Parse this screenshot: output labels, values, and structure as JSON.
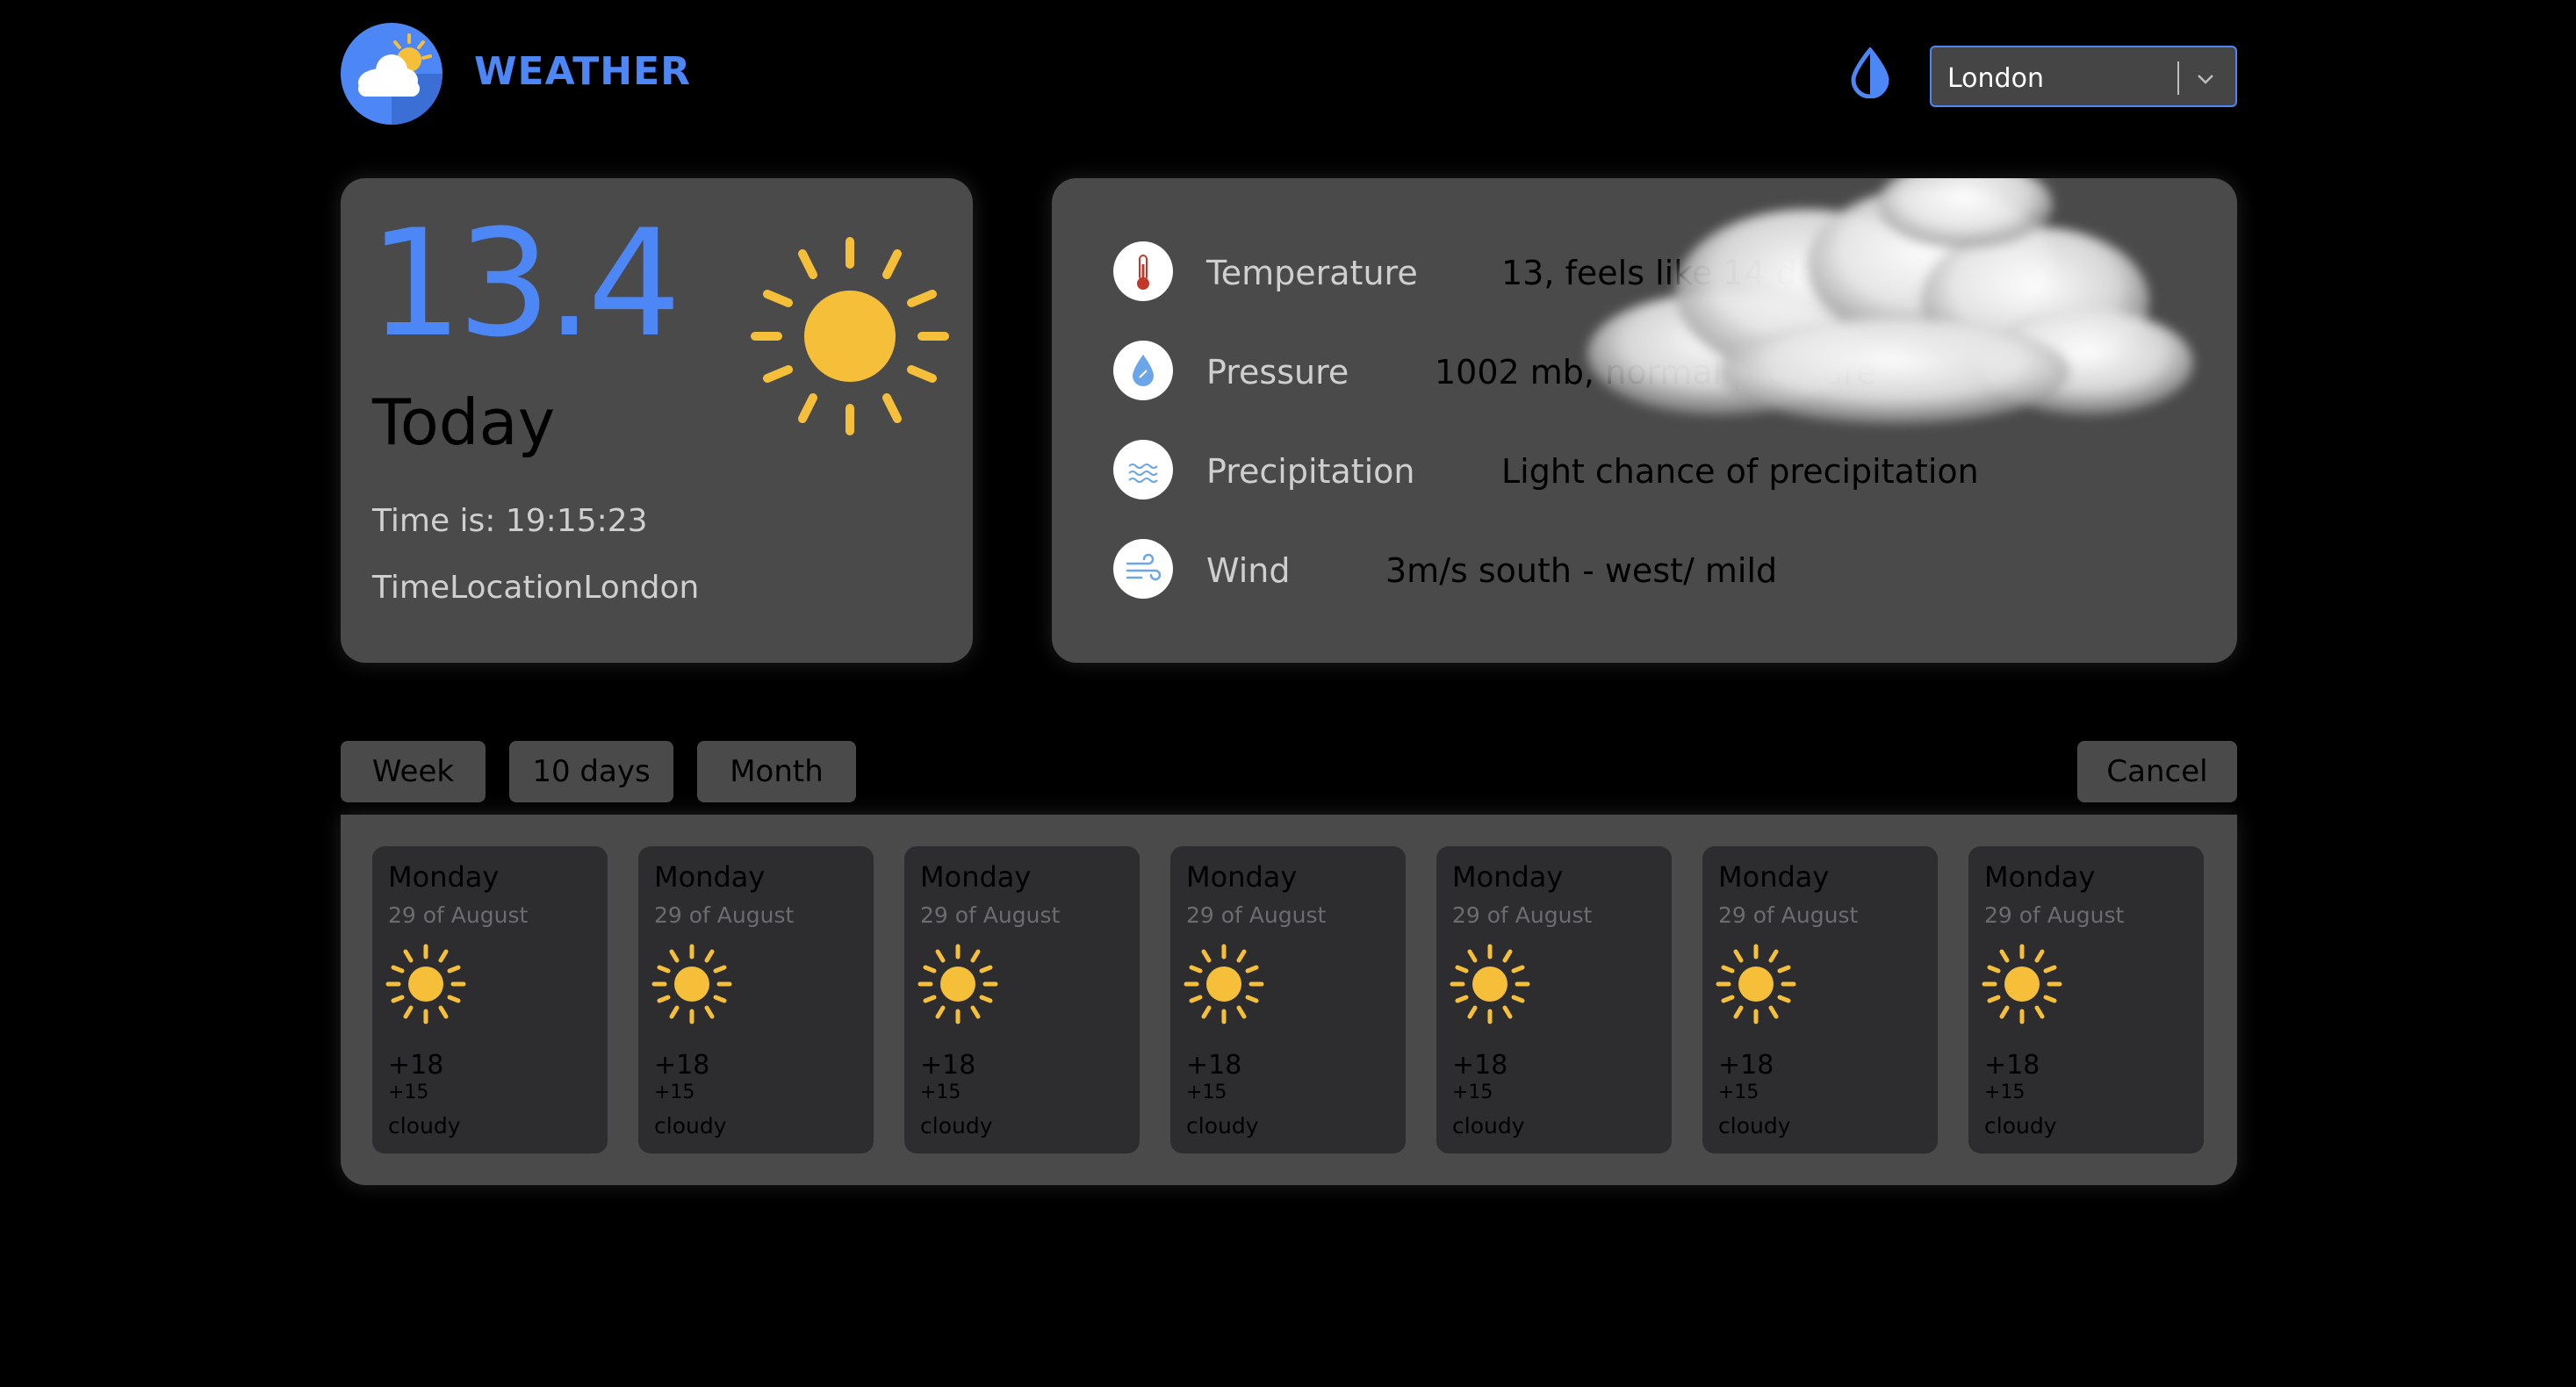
{
  "header": {
    "brand": "WEATHER",
    "city_select": {
      "value": "London"
    }
  },
  "today": {
    "temperature": "13.4",
    "label": "Today",
    "time": "Time is: 19:15:23",
    "location": "TimeLocationLondon"
  },
  "details": [
    {
      "icon": "thermometer-icon",
      "label": "Temperature",
      "value": "13, feels like 14 degrees"
    },
    {
      "icon": "pressure-drop-icon",
      "label": "Pressure",
      "value": "1002 mb, normal pressure"
    },
    {
      "icon": "precipitation-icon",
      "label": "Precipitation",
      "value": "Light chance of precipitation"
    },
    {
      "icon": "wind-icon",
      "label": "Wind",
      "value": "3m/s south - west/ mild"
    }
  ],
  "tabs": {
    "week": "Week",
    "ten_days": "10 days",
    "month": "Month",
    "cancel": "Cancel"
  },
  "forecast": [
    {
      "day": "Monday",
      "date": "29 of August",
      "icon": "sun-icon",
      "high": "+18",
      "low": "+15",
      "desc": "cloudy"
    },
    {
      "day": "Monday",
      "date": "29 of August",
      "icon": "sun-icon",
      "high": "+18",
      "low": "+15",
      "desc": "cloudy"
    },
    {
      "day": "Monday",
      "date": "29 of August",
      "icon": "sun-icon",
      "high": "+18",
      "low": "+15",
      "desc": "cloudy"
    },
    {
      "day": "Monday",
      "date": "29 of August",
      "icon": "sun-icon",
      "high": "+18",
      "low": "+15",
      "desc": "cloudy"
    },
    {
      "day": "Monday",
      "date": "29 of August",
      "icon": "sun-icon",
      "high": "+18",
      "low": "+15",
      "desc": "cloudy"
    },
    {
      "day": "Monday",
      "date": "29 of August",
      "icon": "sun-icon",
      "high": "+18",
      "low": "+15",
      "desc": "cloudy"
    },
    {
      "day": "Monday",
      "date": "29 of August",
      "icon": "sun-icon",
      "high": "+18",
      "low": "+15",
      "desc": "cloudy"
    }
  ],
  "colors": {
    "accent": "#4c87f5",
    "sun": "#f5bf3a",
    "card": "#4a4a4a",
    "day_card": "#2d2d30",
    "page": "#000000"
  }
}
